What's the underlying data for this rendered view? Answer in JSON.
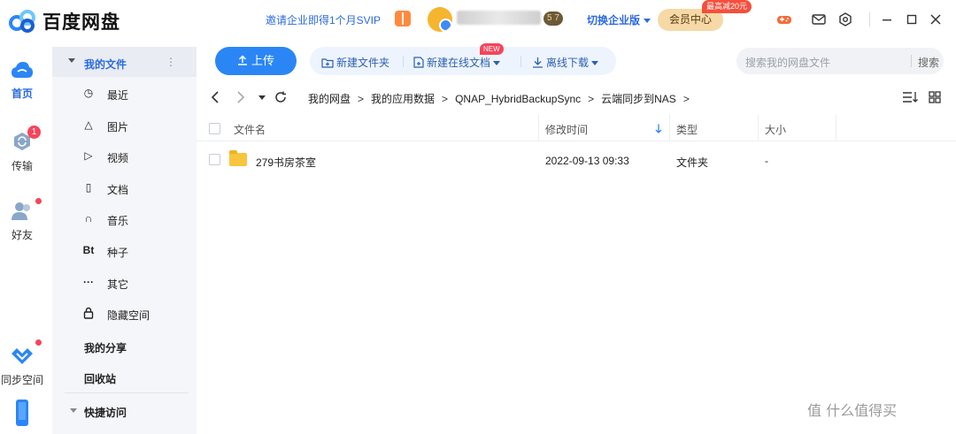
{
  "app": {
    "title": "百度网盘",
    "invite_text": "邀请企业即得1个月SVIP",
    "svip_level": "5 7",
    "switch_enterprise": "切换企业版",
    "member_center": "会员中心",
    "promo_badge": "最高减20元",
    "accent": "#2b86f5"
  },
  "rail": {
    "home": "首页",
    "transfer": "传输",
    "transfer_badge": "1",
    "friends": "好友",
    "sync_space": "同步空间"
  },
  "sidebar": {
    "my_files": "我的文件",
    "more": "⋮",
    "items": [
      {
        "icon": "clock-icon",
        "glyph": "◷",
        "label": "最近"
      },
      {
        "icon": "image-icon",
        "glyph": "△",
        "label": "图片"
      },
      {
        "icon": "video-icon",
        "glyph": "▷",
        "label": "视频"
      },
      {
        "icon": "document-icon",
        "glyph": "▯",
        "label": "文档"
      },
      {
        "icon": "music-icon",
        "glyph": "∩",
        "label": "音乐"
      },
      {
        "icon": "bt-icon",
        "glyph": "Bt",
        "label": "种子"
      },
      {
        "icon": "more-icon",
        "glyph": "···",
        "label": "其它"
      },
      {
        "icon": "lock-icon",
        "glyph": "🔒",
        "label": "隐藏空间"
      }
    ],
    "my_share": "我的分享",
    "recycle_bin": "回收站",
    "quick_access": "快捷访问"
  },
  "toolbar": {
    "upload": "上传",
    "new_folder": "新建文件夹",
    "new_online_doc": "新建在线文档",
    "new_tag": "NEW",
    "offline_download": "离线下载",
    "search_placeholder": "搜索我的网盘文件",
    "search_button": "搜索"
  },
  "breadcrumb": [
    "我的网盘",
    "我的应用数据",
    "QNAP_HybridBackupSync",
    "云端同步到NAS"
  ],
  "table": {
    "headers": {
      "name": "文件名",
      "modified": "修改时间",
      "type": "类型",
      "size": "大小"
    },
    "rows": [
      {
        "name": "279书房茶室",
        "modified": "2022-09-13 09:33",
        "type": "文件夹",
        "size": "-"
      }
    ]
  },
  "watermark": "值 什么值得买"
}
